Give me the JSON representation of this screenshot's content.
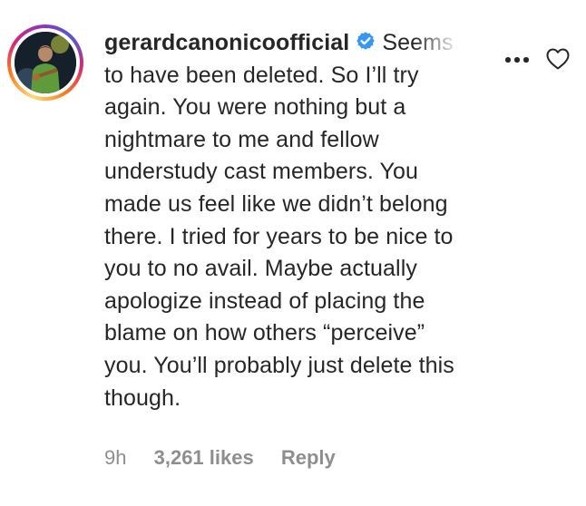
{
  "comment": {
    "username": "gerardcanonicoofficial",
    "verified": true,
    "first_line_visible": "Seems",
    "lines": [
      "to have been deleted. So I’ll try",
      "again. You were nothing but a",
      "nightmare to me and fellow",
      "understudy cast members. You",
      "made us feel like we didn’t belong",
      "there. I tried for years to be nice to",
      "you to no avail. Maybe actually",
      "apologize instead of placing the",
      "blame on how others “perceive”",
      "you. You’ll probably just delete this",
      "though."
    ],
    "timestamp": "9h",
    "likes": "3,261 likes",
    "reply_label": "Reply"
  },
  "icons": {
    "verified": "verified-badge-icon",
    "more": "more-options-icon",
    "like": "heart-outline-icon"
  },
  "colors": {
    "text": "#262626",
    "meta": "#8e8e8e",
    "verified_blue": "#3897f0",
    "background": "#ffffff"
  }
}
